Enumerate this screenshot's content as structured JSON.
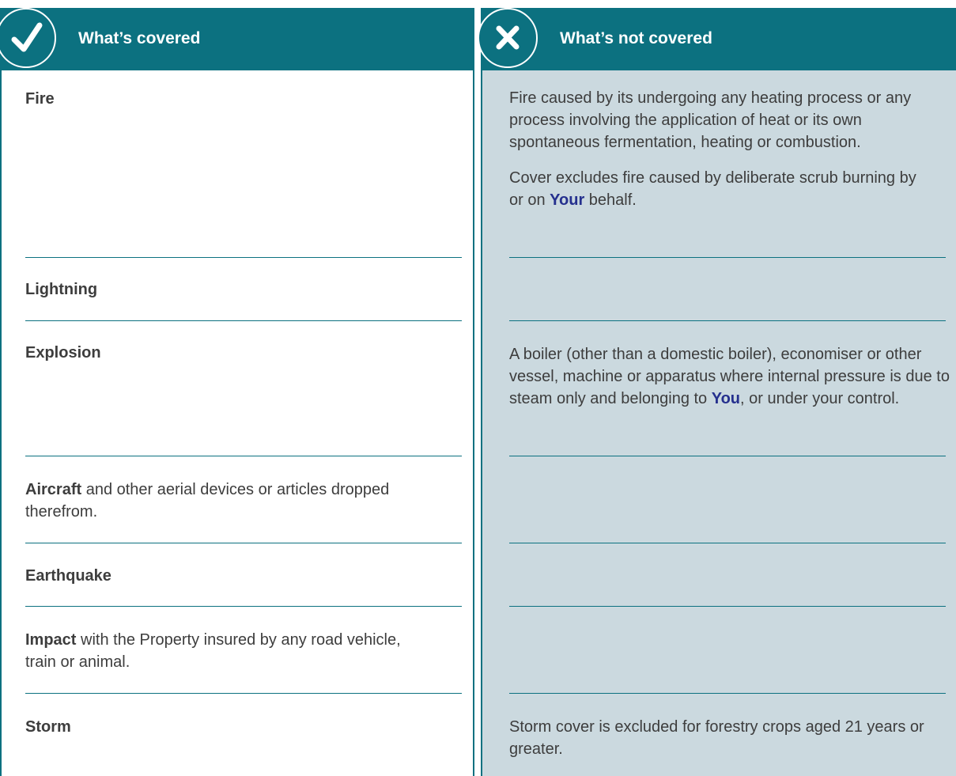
{
  "covered": {
    "header": "What’s covered",
    "rows": [
      {
        "term": "Fire",
        "rest": ""
      },
      {
        "term": "Lightning",
        "rest": ""
      },
      {
        "term": "Explosion",
        "rest": ""
      },
      {
        "term": "Aircraft",
        "rest": " and other aerial devices or articles dropped therefrom."
      },
      {
        "term": "Earthquake",
        "rest": ""
      },
      {
        "term": "Impact",
        "rest": " with the Property insured by any road vehicle, train or animal."
      },
      {
        "term": "Storm",
        "rest": ""
      }
    ]
  },
  "not_covered": {
    "header": "What’s not covered",
    "fire": {
      "p1": "Fire caused by its undergoing any heating process or any process involving the application of heat or its own spontaneous fermentation, heating or combustion.",
      "p2_before": "Cover excludes fire caused by deliberate scrub burning by or on ",
      "p2_keyword": "Your",
      "p2_after": " behalf."
    },
    "explosion": {
      "before": "A boiler (other than a domestic boiler), economiser or other vessel, machine or apparatus where internal pressure is due to steam only and belonging to ",
      "keyword": "You",
      "after": ", or under your control."
    },
    "storm": "Storm cover is excluded for forestry crops aged 21 years or greater."
  },
  "colors": {
    "header_bg": "#0c7180",
    "not_covered_bg": "#cbd9df",
    "keyword": "#25308e"
  },
  "icons": [
    "checkmark-icon",
    "cross-icon"
  ]
}
